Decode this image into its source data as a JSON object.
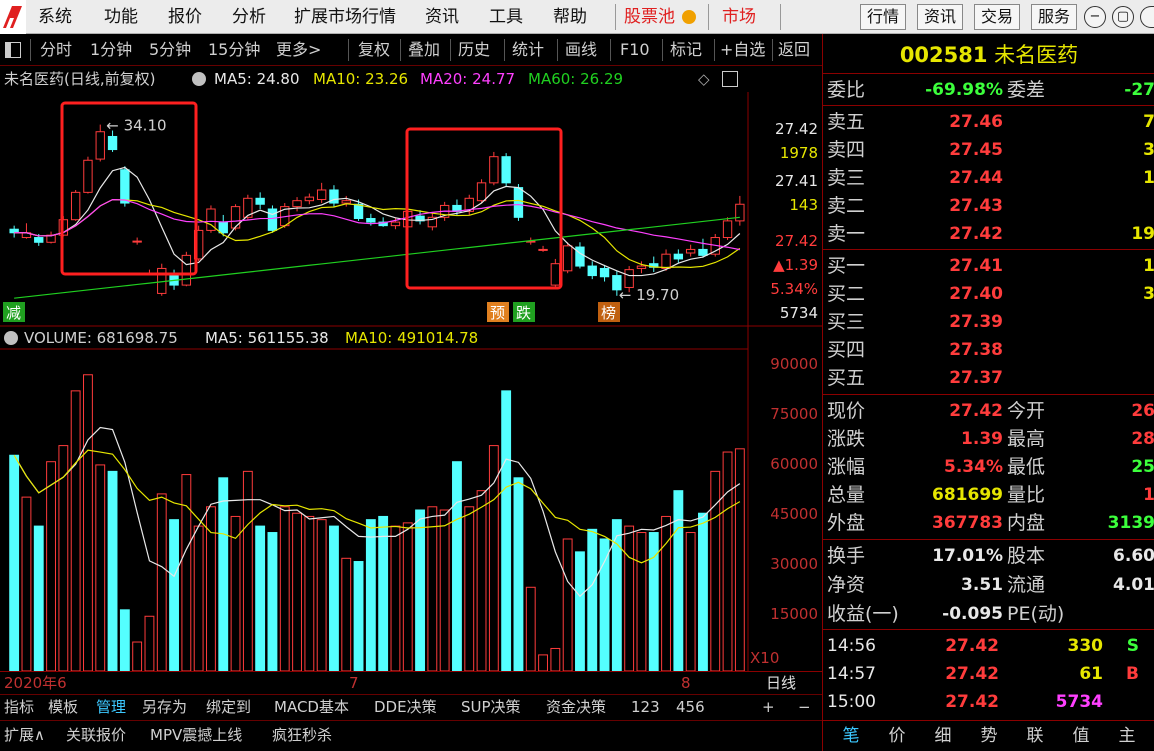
{
  "menubar": {
    "items": [
      "系统",
      "功能",
      "报价",
      "分析",
      "扩展市场行情",
      "资讯",
      "工具",
      "帮助"
    ],
    "highlight": [
      "股票池",
      "市场"
    ],
    "right_buttons": [
      "行情",
      "资讯",
      "交易",
      "服务"
    ]
  },
  "toolbar": {
    "left": [
      "分时",
      "1分钟",
      "5分钟",
      "15分钟",
      "更多>"
    ],
    "right": [
      "复权",
      "叠加",
      "历史",
      "统计",
      "画线",
      "F10",
      "标记",
      "+自选",
      "返回"
    ]
  },
  "stock": {
    "code": "002581",
    "name": "未名医药"
  },
  "ma_line": {
    "title": "未名医药(日线,前复权)",
    "ma5": "MA5: 24.80",
    "ma10": "MA10: 23.26",
    "ma20": "MA20: 24.77",
    "ma60": "MA60: 26.29"
  },
  "annotations": {
    "high": "34.10",
    "low": "19.70",
    "tags": [
      "减",
      "预",
      "跌",
      "榜"
    ]
  },
  "price_axis": [
    "27.42",
    "1978",
    "27.41",
    "143",
    "27.42",
    "▲1.39",
    "5.34%",
    "5734"
  ],
  "volume_line": {
    "label": "VOLUME: 681698.75",
    "ma5": "MA5: 561155.38",
    "ma10": "MA10: 491014.78"
  },
  "volume_axis": [
    "90000",
    "75000",
    "60000",
    "45000",
    "30000",
    "15000",
    "X10"
  ],
  "date_axis": [
    "2020年6",
    "7",
    "8"
  ],
  "period": "日线",
  "bottom_tabs": [
    "指标",
    "模板",
    "管理",
    "另存为",
    "绑定到",
    "MACD基本",
    "DDE决策",
    "SUP决策",
    "资金决策",
    "123",
    "456"
  ],
  "bottom_tabs2": [
    "扩展∧",
    "关联报价",
    "MPV震撼上线",
    "疯狂秒杀"
  ],
  "right_bottom_tabs": [
    "笔",
    "价",
    "细",
    "势",
    "联",
    "值",
    "主"
  ],
  "order_book": {
    "wei_bi_label": "委比",
    "wei_bi": "-69.98%",
    "wei_cha_label": "委差",
    "wei_cha": "-27",
    "sell": [
      {
        "label": "卖五",
        "price": "27.46",
        "vol": "7"
      },
      {
        "label": "卖四",
        "price": "27.45",
        "vol": "3"
      },
      {
        "label": "卖三",
        "price": "27.44",
        "vol": "1"
      },
      {
        "label": "卖二",
        "price": "27.43",
        "vol": ""
      },
      {
        "label": "卖一",
        "price": "27.42",
        "vol": "19"
      }
    ],
    "buy": [
      {
        "label": "买一",
        "price": "27.41",
        "vol": "1"
      },
      {
        "label": "买二",
        "price": "27.40",
        "vol": "3"
      },
      {
        "label": "买三",
        "price": "27.39",
        "vol": ""
      },
      {
        "label": "买四",
        "price": "27.38",
        "vol": ""
      },
      {
        "label": "买五",
        "price": "27.37",
        "vol": ""
      }
    ]
  },
  "quote": [
    {
      "l1": "现价",
      "v1": "27.42",
      "c1": "red",
      "l2": "今开",
      "v2": "26",
      "c2": "red"
    },
    {
      "l1": "涨跌",
      "v1": "1.39",
      "c1": "red",
      "l2": "最高",
      "v2": "28",
      "c2": "red"
    },
    {
      "l1": "涨幅",
      "v1": "5.34%",
      "c1": "red",
      "l2": "最低",
      "v2": "25",
      "c2": "grn"
    },
    {
      "l1": "总量",
      "v1": "681699",
      "c1": "yel",
      "l2": "量比",
      "v2": "1",
      "c2": "red"
    },
    {
      "l1": "外盘",
      "v1": "367783",
      "c1": "red",
      "l2": "内盘",
      "v2": "3139",
      "c2": "grn"
    }
  ],
  "fundamentals": [
    {
      "l1": "换手",
      "v1": "17.01%",
      "l2": "股本",
      "v2": "6.60"
    },
    {
      "l1": "净资",
      "v1": "3.51",
      "l2": "流通",
      "v2": "4.01"
    },
    {
      "l1": "收益(一)",
      "v1": "-0.095",
      "l2": "PE(动)",
      "v2": ""
    }
  ],
  "ticks": [
    {
      "time": "14:56",
      "price": "27.42",
      "vol": "330",
      "dir": "S"
    },
    {
      "time": "14:57",
      "price": "27.42",
      "vol": "61",
      "dir": "B"
    },
    {
      "time": "15:00",
      "price": "27.42",
      "vol": "5734",
      "dir": ""
    }
  ],
  "chart_data": {
    "type": "candlestick",
    "candles": [
      {
        "o": 25.3,
        "c": 25.0,
        "h": 25.6,
        "l": 24.6
      },
      {
        "o": 24.6,
        "c": 25.0,
        "h": 25.8,
        "l": 24.5
      },
      {
        "o": 24.6,
        "c": 24.2,
        "h": 24.9,
        "l": 23.9
      },
      {
        "o": 24.2,
        "c": 24.8,
        "h": 25.1,
        "l": 24.1
      },
      {
        "o": 24.8,
        "c": 26.1,
        "h": 26.4,
        "l": 24.7
      },
      {
        "o": 26.1,
        "c": 28.4,
        "h": 28.6,
        "l": 26.0
      },
      {
        "o": 28.4,
        "c": 31.1,
        "h": 31.4,
        "l": 28.3
      },
      {
        "o": 31.2,
        "c": 33.5,
        "h": 34.1,
        "l": 31.0
      },
      {
        "o": 33.1,
        "c": 32.0,
        "h": 33.6,
        "l": 31.8
      },
      {
        "o": 30.3,
        "c": 27.5,
        "h": 30.6,
        "l": 27.2
      },
      {
        "o": 24.3,
        "c": 24.3,
        "h": 24.6,
        "l": 24.0
      },
      {
        "o": 21.6,
        "c": 21.6,
        "h": 21.9,
        "l": 21.6
      },
      {
        "o": 19.9,
        "c": 22.0,
        "h": 22.4,
        "l": 19.7
      },
      {
        "o": 21.4,
        "c": 20.6,
        "h": 21.9,
        "l": 20.2
      },
      {
        "o": 20.6,
        "c": 23.1,
        "h": 23.4,
        "l": 20.5
      },
      {
        "o": 22.8,
        "c": 25.2,
        "h": 25.6,
        "l": 22.6
      },
      {
        "o": 25.2,
        "c": 27.0,
        "h": 27.3,
        "l": 25.0
      },
      {
        "o": 25.9,
        "c": 25.0,
        "h": 26.5,
        "l": 24.7
      },
      {
        "o": 25.4,
        "c": 27.2,
        "h": 27.4,
        "l": 25.2
      },
      {
        "o": 26.3,
        "c": 27.9,
        "h": 28.2,
        "l": 26.1
      },
      {
        "o": 27.9,
        "c": 27.4,
        "h": 28.4,
        "l": 27.0
      },
      {
        "o": 27.0,
        "c": 25.2,
        "h": 27.3,
        "l": 25.0
      },
      {
        "o": 25.6,
        "c": 27.2,
        "h": 27.5,
        "l": 25.4
      },
      {
        "o": 27.2,
        "c": 27.7,
        "h": 28.0,
        "l": 26.8
      },
      {
        "o": 27.7,
        "c": 28.0,
        "h": 28.3,
        "l": 27.4
      },
      {
        "o": 27.8,
        "c": 28.6,
        "h": 29.2,
        "l": 27.5
      },
      {
        "o": 28.6,
        "c": 27.5,
        "h": 29.0,
        "l": 27.2
      },
      {
        "o": 27.5,
        "c": 27.7,
        "h": 28.1,
        "l": 27.2
      },
      {
        "o": 27.4,
        "c": 26.2,
        "h": 27.8,
        "l": 26.0
      },
      {
        "o": 26.2,
        "c": 25.9,
        "h": 26.6,
        "l": 25.6
      },
      {
        "o": 25.9,
        "c": 25.6,
        "h": 26.3,
        "l": 25.5
      },
      {
        "o": 25.6,
        "c": 25.9,
        "h": 26.3,
        "l": 25.3
      },
      {
        "o": 25.5,
        "c": 26.8,
        "h": 27.1,
        "l": 25.3
      },
      {
        "o": 26.4,
        "c": 26.0,
        "h": 26.9,
        "l": 25.7
      },
      {
        "o": 25.5,
        "c": 26.3,
        "h": 26.7,
        "l": 25.2
      },
      {
        "o": 26.3,
        "c": 27.3,
        "h": 27.6,
        "l": 26.0
      },
      {
        "o": 27.3,
        "c": 26.8,
        "h": 27.8,
        "l": 26.5
      },
      {
        "o": 26.8,
        "c": 27.9,
        "h": 28.2,
        "l": 26.5
      },
      {
        "o": 27.7,
        "c": 29.2,
        "h": 29.5,
        "l": 27.5
      },
      {
        "o": 29.2,
        "c": 31.4,
        "h": 31.8,
        "l": 29.0
      },
      {
        "o": 31.4,
        "c": 29.2,
        "h": 31.7,
        "l": 28.9
      },
      {
        "o": 28.8,
        "c": 26.3,
        "h": 29.1,
        "l": 26.0
      },
      {
        "o": 24.3,
        "c": 24.3,
        "h": 24.6,
        "l": 24.0
      },
      {
        "o": 23.6,
        "c": 23.6,
        "h": 23.9,
        "l": 23.4
      },
      {
        "o": 20.6,
        "c": 22.4,
        "h": 22.8,
        "l": 20.3
      },
      {
        "o": 21.8,
        "c": 23.9,
        "h": 24.2,
        "l": 21.6
      },
      {
        "o": 23.8,
        "c": 22.2,
        "h": 24.2,
        "l": 22.0
      },
      {
        "o": 22.2,
        "c": 21.4,
        "h": 22.6,
        "l": 21.1
      },
      {
        "o": 22.0,
        "c": 21.3,
        "h": 22.3,
        "l": 20.9
      },
      {
        "o": 21.4,
        "c": 20.2,
        "h": 21.8,
        "l": 19.7
      },
      {
        "o": 20.4,
        "c": 21.9,
        "h": 22.2,
        "l": 20.0
      },
      {
        "o": 22.0,
        "c": 22.2,
        "h": 22.6,
        "l": 21.6
      },
      {
        "o": 22.4,
        "c": 22.1,
        "h": 23.0,
        "l": 21.7
      },
      {
        "o": 22.0,
        "c": 23.2,
        "h": 23.6,
        "l": 21.8
      },
      {
        "o": 23.2,
        "c": 22.8,
        "h": 23.6,
        "l": 22.5
      },
      {
        "o": 23.3,
        "c": 23.6,
        "h": 24.0,
        "l": 23.0
      },
      {
        "o": 23.6,
        "c": 23.1,
        "h": 24.5,
        "l": 22.9
      },
      {
        "o": 23.2,
        "c": 24.6,
        "h": 24.9,
        "l": 23.0
      },
      {
        "o": 24.6,
        "c": 26.0,
        "h": 26.3,
        "l": 24.4
      },
      {
        "o": 26.0,
        "c": 27.4,
        "h": 28.1,
        "l": 25.6
      }
    ],
    "volumes": [
      67000,
      54000,
      45000,
      65000,
      70000,
      87000,
      92000,
      64000,
      62000,
      19000,
      9000,
      17000,
      55000,
      47000,
      61000,
      45000,
      51000,
      60000,
      48000,
      62000,
      45000,
      43000,
      51000,
      49000,
      48000,
      47000,
      45000,
      35000,
      34000,
      47000,
      48000,
      45000,
      46000,
      50000,
      51000,
      50000,
      65000,
      51000,
      56000,
      70000,
      87000,
      60000,
      26000,
      5000,
      7000,
      41000,
      37000,
      44000,
      41000,
      47000,
      45000,
      43000,
      43000,
      48000,
      56000,
      43000,
      49000,
      62000,
      68000,
      69000
    ],
    "ma_series": [
      {
        "name": "MA5",
        "color": "#e8e8e8"
      },
      {
        "name": "MA10",
        "color": "#e6e600"
      },
      {
        "name": "MA20",
        "color": "#ff40ff"
      },
      {
        "name": "MA60",
        "color": "#20d020"
      }
    ],
    "price_ylim": [
      18,
      36
    ],
    "volume_ylim": [
      0,
      100000
    ]
  }
}
